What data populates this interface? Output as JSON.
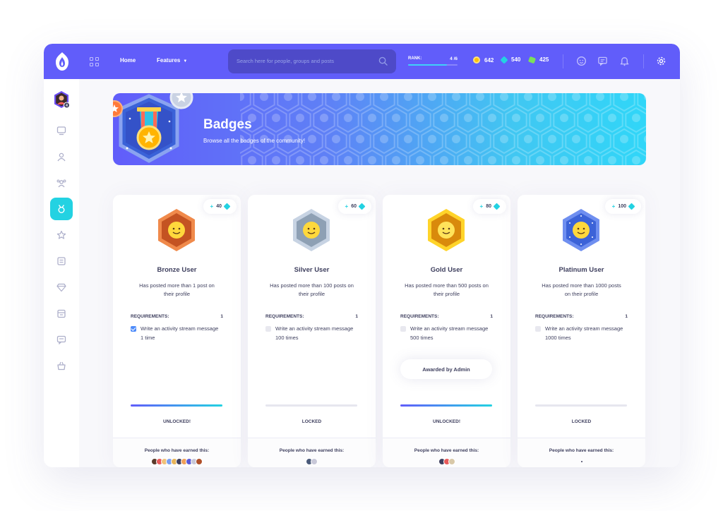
{
  "header": {
    "nav": {
      "home": "Home",
      "features": "Features"
    },
    "search": {
      "placeholder": "Search here for people, groups and posts"
    },
    "rank": {
      "label": "RANK:",
      "value": "4 /6",
      "progress": 0.78
    },
    "stats": [
      {
        "name": "gold-coins",
        "value": "642",
        "color": "#ffc107"
      },
      {
        "name": "blue-gems",
        "value": "540",
        "color": "#23d2e2"
      },
      {
        "name": "green-gems",
        "value": "425",
        "color": "#7be05b"
      }
    ],
    "colors": {
      "bar": "#615dfa",
      "accent": "#23d2e2"
    }
  },
  "sidebar": {
    "avatar_level": "4",
    "items": [
      "newsfeed-icon",
      "profile-icon",
      "friends-icon",
      "badges-icon",
      "quests-icon",
      "groups-icon",
      "marketplace-icon",
      "events-icon",
      "forums-icon",
      "streams-icon"
    ],
    "active": "badges-icon"
  },
  "banner": {
    "title": "Badges",
    "subtitle": "Browse all the badges of the community!"
  },
  "cards": [
    {
      "points": "40",
      "title": "Bronze User",
      "description": "Has posted more than 1 post on their profile",
      "requirements_label": "REQUIREMENTS:",
      "requirements_count": "1",
      "requirement": "Write an activity stream message 1 time",
      "checked": true,
      "progress": 1,
      "status": "UNLOCKED!",
      "earned_label": "People who have earned this:",
      "badge_color": "#d4652d"
    },
    {
      "points": "60",
      "title": "Silver User",
      "description": "Has posted more than 100 posts on their profile",
      "requirements_label": "REQUIREMENTS:",
      "requirements_count": "1",
      "requirement": "Write an activity stream message 100 times",
      "checked": false,
      "progress": 0,
      "status": "LOCKED",
      "earned_label": "People who have earned this:",
      "badge_color": "#8ea0b4"
    },
    {
      "points": "80",
      "title": "Gold User",
      "description": "Has posted more than 500 posts on their profile",
      "requirements_label": "REQUIREMENTS:",
      "requirements_count": "1",
      "requirement": "Write an activity stream message 500 times",
      "checked": false,
      "awarded": "Awarded by Admin",
      "progress": 1,
      "status": "UNLOCKED!",
      "earned_label": "People who have earned this:",
      "badge_color": "#e59a12"
    },
    {
      "points": "100",
      "title": "Platinum User",
      "description": "Has posted more than 1000 posts on their profile",
      "requirements_label": "REQUIREMENTS:",
      "requirements_count": "1",
      "requirement": "Write an activity stream message 1000 times",
      "checked": false,
      "progress": 0,
      "status": "LOCKED",
      "earned_label": "People who have earned this:",
      "badge_color": "#3c63d8"
    }
  ]
}
